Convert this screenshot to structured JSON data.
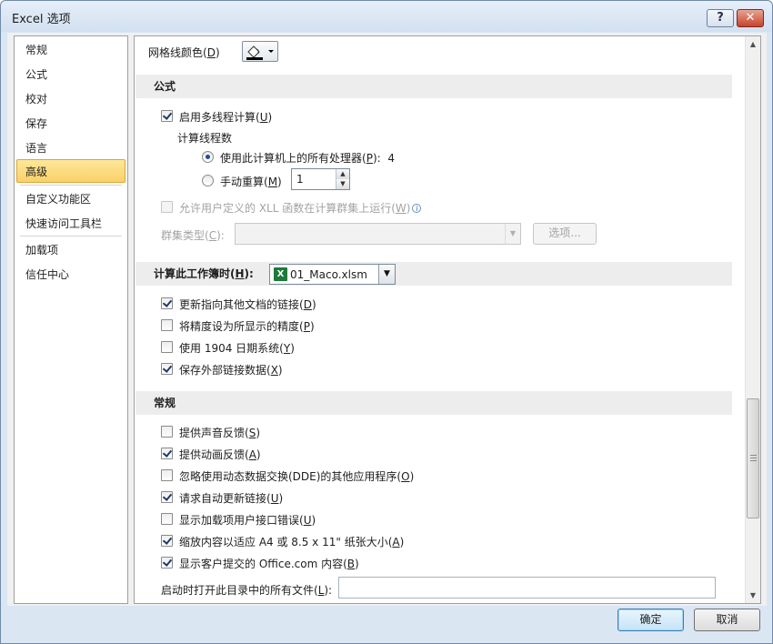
{
  "window": {
    "title": "Excel 选项",
    "help_label": "?",
    "close_label": "✕"
  },
  "nav": {
    "items": [
      {
        "label": "常规"
      },
      {
        "label": "公式"
      },
      {
        "label": "校对"
      },
      {
        "label": "保存"
      },
      {
        "label": "语言"
      },
      {
        "label": "高级"
      },
      {
        "label": "自定义功能区"
      },
      {
        "label": "快速访问工具栏"
      },
      {
        "label": "加载项"
      },
      {
        "label": "信任中心"
      }
    ],
    "selected_index": 5
  },
  "gridline": {
    "label": "网格线颜色(",
    "key": "D",
    "suffix": ")"
  },
  "formulas": {
    "header": "公式",
    "multithread": {
      "label": "启用多线程计算(",
      "key": "U",
      "suffix": ")",
      "checked": true
    },
    "threads_label": "计算线程数",
    "use_all": {
      "label": "使用此计算机上的所有处理器(",
      "key": "P",
      "suffix": "):",
      "checked": true,
      "value": "4"
    },
    "manual": {
      "label": "手动重算(",
      "key": "M",
      "suffix": ")",
      "checked": false,
      "value": "1"
    },
    "xll": {
      "label": "允许用户定义的 XLL 函数在计算群集上运行(",
      "key": "W",
      "suffix": ")",
      "checked": false,
      "info": "i"
    },
    "cluster": {
      "label": "群集类型(",
      "key": "C",
      "suffix": "):",
      "button": "选项..."
    }
  },
  "workbook": {
    "header_label": "计算此工作簿时(",
    "header_key": "H",
    "header_suffix": "):",
    "file": "01_Maco.xlsm",
    "items": [
      {
        "label": "更新指向其他文档的链接(",
        "key": "D",
        "suffix": ")",
        "checked": true
      },
      {
        "label": "将精度设为所显示的精度(",
        "key": "P",
        "suffix": ")",
        "checked": false
      },
      {
        "label": "使用 1904 日期系统(",
        "key": "Y",
        "suffix": ")",
        "checked": false
      },
      {
        "label": "保存外部链接数据(",
        "key": "X",
        "suffix": ")",
        "checked": true
      }
    ]
  },
  "general": {
    "header": "常规",
    "items": [
      {
        "label": "提供声音反馈(",
        "key": "S",
        "suffix": ")",
        "checked": false
      },
      {
        "label": "提供动画反馈(",
        "key": "A",
        "suffix": ")",
        "checked": true
      },
      {
        "label": "忽略使用动态数据交换(DDE)的其他应用程序(",
        "key": "O",
        "suffix": ")",
        "checked": false
      },
      {
        "label": "请求自动更新链接(",
        "key": "U",
        "suffix": ")",
        "checked": true
      },
      {
        "label": "显示加载项用户接口错误(",
        "key": "U",
        "suffix": ")",
        "checked": false
      },
      {
        "label": "缩放内容以适应 A4 或 8.5 x 11\" 纸张大小(",
        "key": "A",
        "suffix": ")",
        "checked": true
      },
      {
        "label": "显示客户提交的 Office.com 内容(",
        "key": "B",
        "suffix": ")",
        "checked": true
      }
    ],
    "startup": {
      "label": "启动时打开此目录中的所有文件(",
      "key": "L",
      "suffix": "):",
      "value": ""
    }
  },
  "footer": {
    "ok": "确定",
    "cancel": "取消"
  }
}
